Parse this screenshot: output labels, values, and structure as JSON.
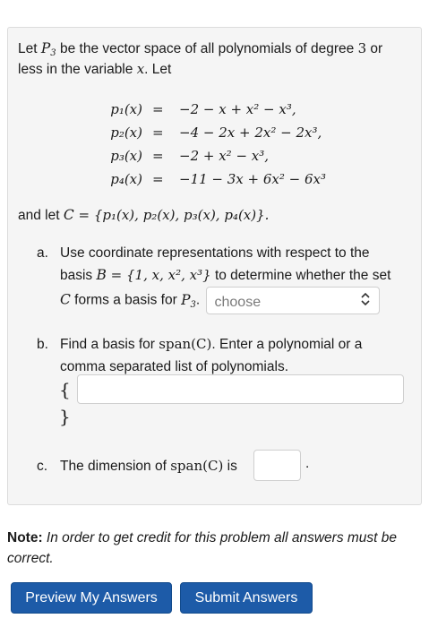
{
  "problem": {
    "intro_line1_pre": "Let ",
    "space_name": "P",
    "space_sub": "3",
    "intro_line1_post": " be the vector space of all polynomials of degree ",
    "degree": "3",
    "intro_or": " or",
    "intro_line2_pre": "less in the variable ",
    "variable": "x",
    "intro_line2_post": ". Let",
    "equations": [
      {
        "lhs": "p₁(x)",
        "eq": "=",
        "rhs": "−2 − x + x² − x³,"
      },
      {
        "lhs": "p₂(x)",
        "eq": "=",
        "rhs": "−4 − 2x + 2x² − 2x³,"
      },
      {
        "lhs": "p₃(x)",
        "eq": "=",
        "rhs": "−2 + x² − x³,"
      },
      {
        "lhs": "p₄(x)",
        "eq": "=",
        "rhs": "−11 − 3x + 6x² − 6x³"
      }
    ],
    "andlet_pre": "and let ",
    "set_name": "C",
    "set_def": " = {p₁(x), p₂(x), p₃(x), p₄(x)}."
  },
  "parts": {
    "a": {
      "letter": "a.",
      "line1": "Use coordinate representations with respect to the",
      "line2_pre": "basis ",
      "basis_name": "B",
      "basis_def": " = {1, x, x², x³}",
      "line2_post": " to determine whether the set",
      "line3_set": "C",
      "line3_mid": " forms a basis for ",
      "line3_space": "P",
      "line3_space_sub": "3",
      "line3_end": ".",
      "select_value": "choose"
    },
    "b": {
      "letter": "b.",
      "line1_pre": "Find a basis for ",
      "span": "span(C)",
      "line1_post": ". Enter a polynomial or a",
      "line2": "comma separated list of polynomials.",
      "open_brace": "{",
      "close_brace": "}",
      "input_value": ""
    },
    "c": {
      "letter": "c.",
      "text_pre": "The dimension of ",
      "span": "span(C)",
      "text_post": " is",
      "input_value": "",
      "end_period": "."
    }
  },
  "note": {
    "label": "Note:",
    "text": " In order to get credit for this problem all answers must be correct."
  },
  "buttons": {
    "preview": "Preview My Answers",
    "submit": "Submit Answers"
  },
  "colors": {
    "button_bg": "#1d5ba8",
    "panel_bg": "#f5f5f5"
  },
  "icons": {
    "select_arrow": "up-down-chevron-icon"
  }
}
